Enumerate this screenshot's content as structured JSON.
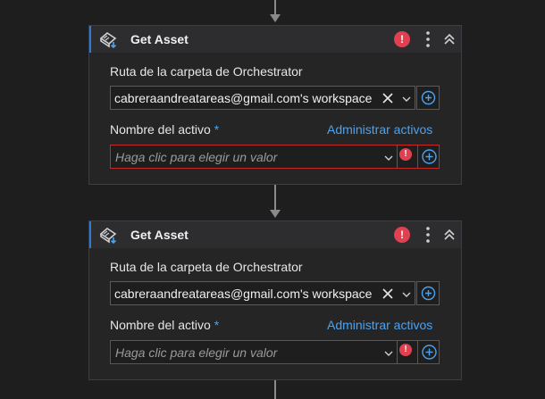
{
  "activities": [
    {
      "title": "Get Asset",
      "folder_label": "Ruta de la carpeta de Orchestrator",
      "folder_value": "cabreraandreatareas@gmail.com's workspace",
      "asset_label": "Nombre del activo",
      "required_mark": "*",
      "manage_link": "Administrar activos",
      "asset_placeholder": "Haga clic para elegir un valor",
      "error_mark": "!"
    },
    {
      "title": "Get Asset",
      "folder_label": "Ruta de la carpeta de Orchestrator",
      "folder_value": "cabreraandreatareas@gmail.com's workspace",
      "asset_label": "Nombre del activo",
      "required_mark": "*",
      "manage_link": "Administrar activos",
      "asset_placeholder": "Haga clic para elegir un valor",
      "error_mark": "!"
    }
  ],
  "colors": {
    "background": "#1e1e1e",
    "card": "#252526",
    "header": "#2d2d30",
    "accent": "#4aa3f0",
    "error": "#e0404f"
  },
  "icons": [
    "get-asset-icon",
    "error-icon",
    "more-options-icon",
    "collapse-icon",
    "clear-icon",
    "chevron-down-icon",
    "add-variable-icon"
  ]
}
